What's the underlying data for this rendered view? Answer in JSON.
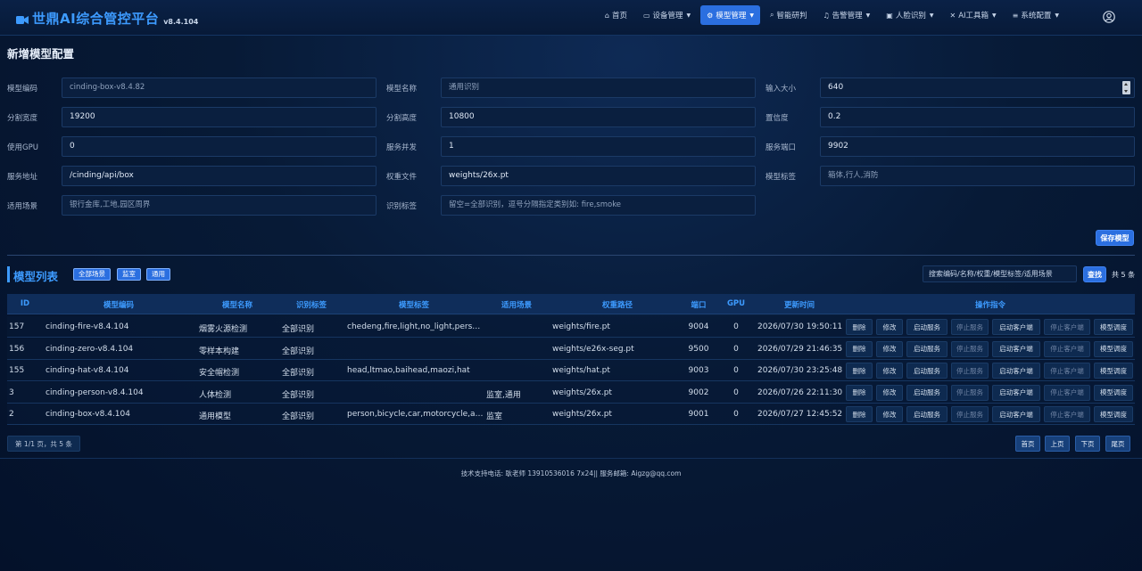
{
  "brand": {
    "title": "世鼎AI综合管控平台",
    "version": "v8.4.104",
    "accent": "#3d9bff"
  },
  "nav": [
    {
      "label": "首页",
      "icon": "home-icon",
      "glyph": "⌂",
      "dropdown": false,
      "active": false
    },
    {
      "label": "设备管理",
      "icon": "camera-icon",
      "glyph": "▭",
      "dropdown": true,
      "active": false
    },
    {
      "label": "模型管理",
      "icon": "gear-icon",
      "glyph": "⚙",
      "dropdown": true,
      "active": true
    },
    {
      "label": "智能研判",
      "icon": "search-icon",
      "glyph": "⌕",
      "dropdown": false,
      "active": false
    },
    {
      "label": "告警管理",
      "icon": "bell-icon",
      "glyph": "♫",
      "dropdown": true,
      "active": false
    },
    {
      "label": "人脸识别",
      "icon": "id-card-icon",
      "glyph": "▣",
      "dropdown": true,
      "active": false
    },
    {
      "label": "AI工具箱",
      "icon": "tools-icon",
      "glyph": "✕",
      "dropdown": true,
      "active": false
    },
    {
      "label": "系统配置",
      "icon": "sliders-icon",
      "glyph": "≡",
      "dropdown": true,
      "active": false
    }
  ],
  "form": {
    "title": "新增模型配置",
    "rows": [
      [
        {
          "label": "模型编码",
          "value": "cinding-box-v8.4.82",
          "is_placeholder": true
        },
        {
          "label": "模型名称",
          "value": "通用识别",
          "is_placeholder": true
        },
        {
          "label": "输入大小",
          "value": "640",
          "is_placeholder": false,
          "spinner": true
        }
      ],
      [
        {
          "label": "分割宽度",
          "value": "19200",
          "is_placeholder": false
        },
        {
          "label": "分割高度",
          "value": "10800",
          "is_placeholder": false
        },
        {
          "label": "置信度",
          "value": "0.2",
          "is_placeholder": false
        }
      ],
      [
        {
          "label": "使用GPU",
          "value": "0",
          "is_placeholder": false
        },
        {
          "label": "服务并发",
          "value": "1",
          "is_placeholder": false
        },
        {
          "label": "服务端口",
          "value": "9902",
          "is_placeholder": false
        }
      ],
      [
        {
          "label": "服务地址",
          "value": "/cinding/api/box",
          "is_placeholder": false
        },
        {
          "label": "权重文件",
          "value": "weights/26x.pt",
          "is_placeholder": false
        },
        {
          "label": "模型标签",
          "value": "箱体,行人,消防",
          "is_placeholder": true
        }
      ],
      [
        {
          "label": "适用场景",
          "value": "银行金库,工地,园区周界",
          "is_placeholder": true
        },
        {
          "label": "识别标签",
          "value": "留空=全部识别，逗号分隔指定类别如: fire,smoke",
          "is_placeholder": true
        }
      ]
    ],
    "save_label": "保存模型"
  },
  "list": {
    "title": "模型列表",
    "filters": [
      "全部场景",
      "监室",
      "通用"
    ],
    "search_placeholder": "搜索编码/名称/权重/模型标签/适用场景",
    "search_label": "查找",
    "total": "共 5 条",
    "columns": [
      "ID",
      "模型编码",
      "模型名称",
      "识别标签",
      "模型标签",
      "适用场景",
      "权重路径",
      "端口",
      "GPU",
      "更新时间",
      "操作指令"
    ],
    "rows": [
      {
        "id": "157",
        "code": "cinding-fire-v8.4.104",
        "name": "烟雾火源检测",
        "recog": "全部识别",
        "tags": "chedeng,fire,light,no_light,pers…",
        "scene": "",
        "weights": "weights/fire.pt",
        "port": "9004",
        "gpu": "0",
        "updated": "2026/07/30 19:50:11"
      },
      {
        "id": "156",
        "code": "cinding-zero-v8.4.104",
        "name": "零样本构建",
        "recog": "全部识别",
        "tags": "",
        "scene": "",
        "weights": "weights/e26x-seg.pt",
        "port": "9500",
        "gpu": "0",
        "updated": "2026/07/29 21:46:35"
      },
      {
        "id": "155",
        "code": "cinding-hat-v8.4.104",
        "name": "安全帽检测",
        "recog": "全部识别",
        "tags": "head,ltmao,baihead,maozi,hat",
        "scene": "",
        "weights": "weights/hat.pt",
        "port": "9003",
        "gpu": "0",
        "updated": "2026/07/30 23:25:48"
      },
      {
        "id": "3",
        "code": "cinding-person-v8.4.104",
        "name": "人体检测",
        "recog": "全部识别",
        "tags": "",
        "scene": "监室,通用",
        "weights": "weights/26x.pt",
        "port": "9002",
        "gpu": "0",
        "updated": "2026/07/26 22:11:30"
      },
      {
        "id": "2",
        "code": "cinding-box-v8.4.104",
        "name": "通用模型",
        "recog": "全部识别",
        "tags": "person,bicycle,car,motorcycle,a…",
        "scene": "监室",
        "weights": "weights/26x.pt",
        "port": "9001",
        "gpu": "0",
        "updated": "2026/07/27 12:45:52"
      }
    ],
    "actions": [
      {
        "label": "删除",
        "key": "delete",
        "dim": false
      },
      {
        "label": "修改",
        "key": "edit",
        "dim": false
      },
      {
        "label": "启动服务",
        "key": "start-service",
        "dim": false
      },
      {
        "label": "停止服务",
        "key": "stop-service",
        "dim": true
      },
      {
        "label": "启动客户端",
        "key": "start-client",
        "dim": false
      },
      {
        "label": "停止客户端",
        "key": "stop-client",
        "dim": true
      },
      {
        "label": "模型调度",
        "key": "schedule",
        "dim": false
      }
    ]
  },
  "pagination": {
    "info": "第 1/1 页，共 5 条",
    "first": "首页",
    "prev": "上页",
    "next": "下页",
    "last": "尾页"
  },
  "footer": "技术支持电话: 耿老师 13910536016 7x24|| 服务邮箱: Aigzg@qq.com"
}
